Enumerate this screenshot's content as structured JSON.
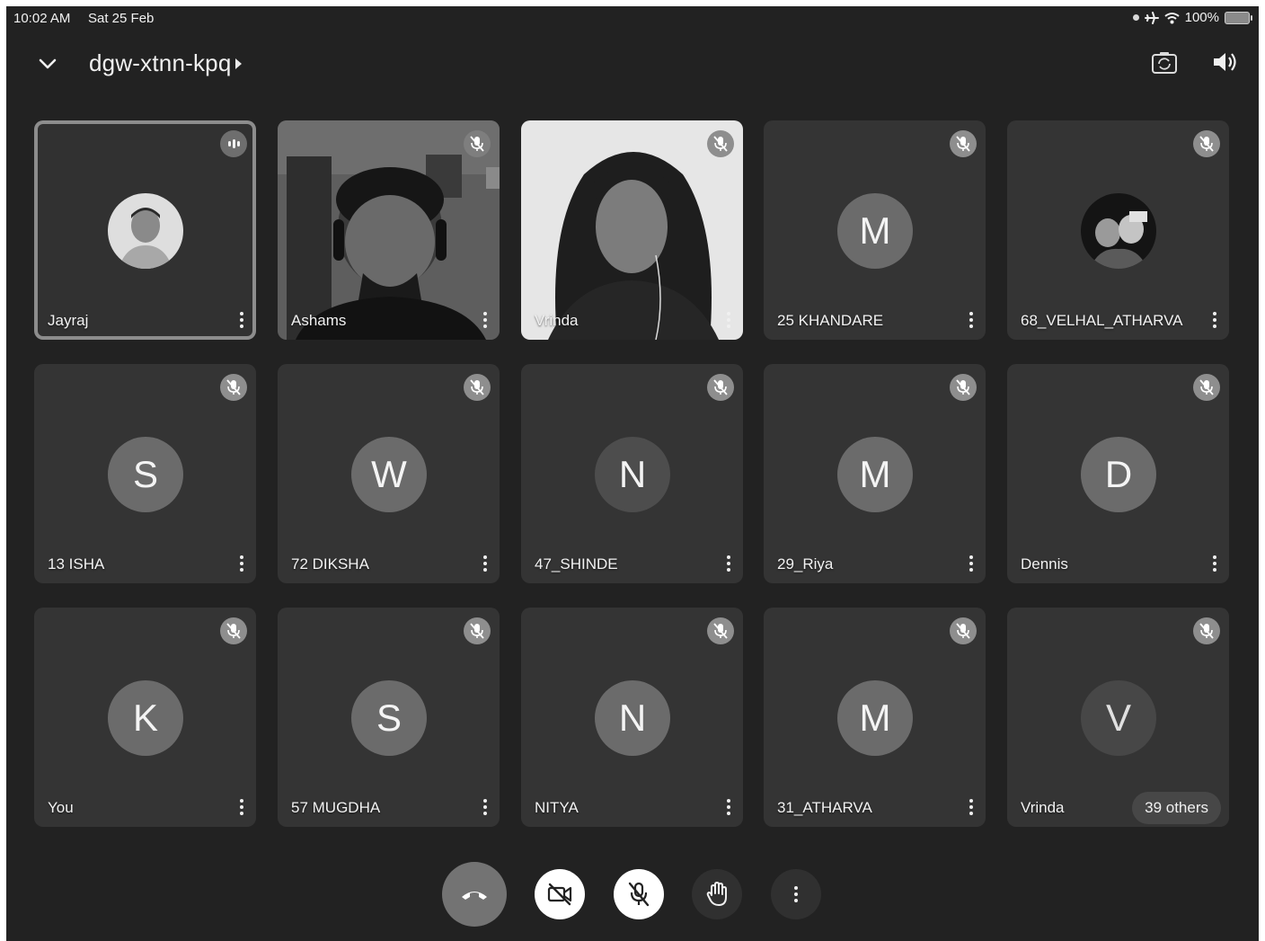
{
  "status_bar": {
    "time": "10:02 AM",
    "date": "Sat 25 Feb",
    "battery": "100%",
    "icons": [
      "dot-icon",
      "airplane-icon",
      "wifi-icon",
      "battery-charging-icon"
    ]
  },
  "header": {
    "meeting_code": "dgw-xtnn-kpq",
    "icons": [
      "chevron-down-icon",
      "caret-right-icon",
      "switch-camera-icon",
      "speaker-icon"
    ]
  },
  "participants": [
    {
      "name": "Jayraj",
      "initial": "",
      "state": "speaking",
      "tile": "photo-avatar",
      "active": true
    },
    {
      "name": "Ashams",
      "initial": "",
      "state": "muted",
      "tile": "video"
    },
    {
      "name": "Vrinda",
      "initial": "",
      "state": "muted",
      "tile": "video"
    },
    {
      "name": "25 KHANDARE",
      "initial": "M",
      "state": "muted",
      "tile": "letter"
    },
    {
      "name": "68_VELHAL_ATHARVA",
      "initial": "",
      "state": "muted",
      "tile": "photo-avatar"
    },
    {
      "name": "13 ISHA",
      "initial": "S",
      "state": "muted",
      "tile": "letter"
    },
    {
      "name": "72 DIKSHA",
      "initial": "W",
      "state": "muted",
      "tile": "letter"
    },
    {
      "name": "47_SHINDE",
      "initial": "N",
      "state": "muted",
      "tile": "letter"
    },
    {
      "name": "29_Riya",
      "initial": "M",
      "state": "muted",
      "tile": "letter"
    },
    {
      "name": "Dennis",
      "initial": "D",
      "state": "muted",
      "tile": "letter"
    },
    {
      "name": "You",
      "initial": "K",
      "state": "muted",
      "tile": "letter"
    },
    {
      "name": "57 MUGDHA",
      "initial": "S",
      "state": "muted",
      "tile": "letter"
    },
    {
      "name": "NITYA",
      "initial": "N",
      "state": "muted",
      "tile": "letter"
    },
    {
      "name": "31_ATHARVA",
      "initial": "M",
      "state": "muted",
      "tile": "letter"
    },
    {
      "name": "Vrinda",
      "initial": "V",
      "state": "muted",
      "tile": "letter-dim",
      "others": "39 others"
    }
  ],
  "controls": [
    {
      "name": "end-call-button",
      "icon": "phone-hangup-icon"
    },
    {
      "name": "camera-off-button",
      "icon": "video-off-icon"
    },
    {
      "name": "mic-off-button",
      "icon": "mic-off-icon"
    },
    {
      "name": "raise-hand-button",
      "icon": "hand-icon"
    },
    {
      "name": "more-options-button",
      "icon": "more-vert-icon"
    }
  ],
  "colors": {
    "background": "#222222",
    "tile": "#343434",
    "avatar": "#6b6b6b",
    "end_call": "#737373"
  }
}
